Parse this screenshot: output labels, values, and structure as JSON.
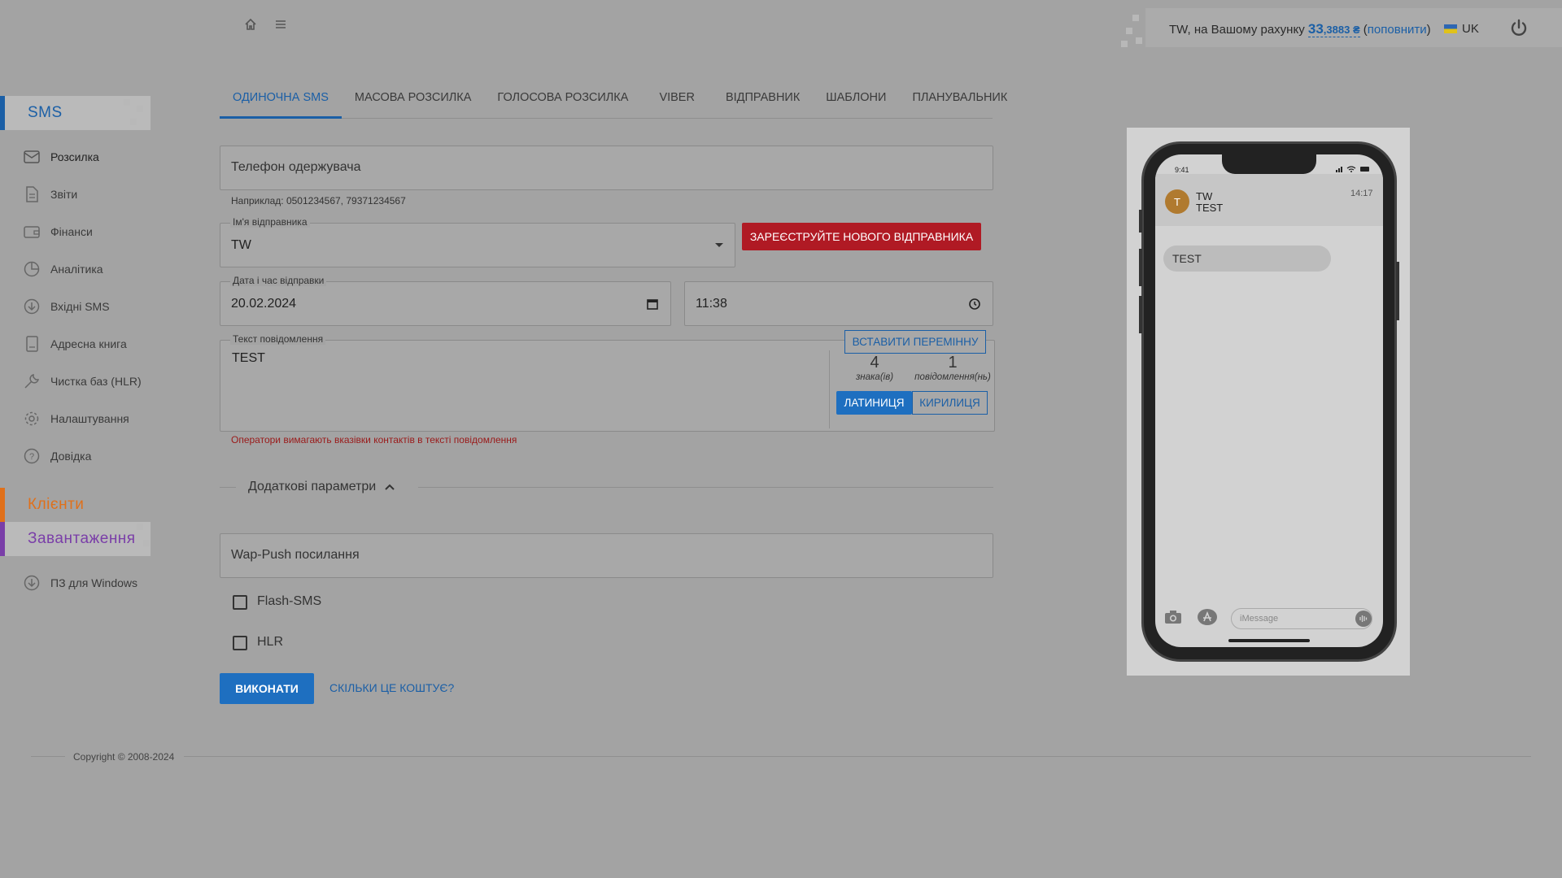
{
  "topbar": {
    "balance_prefix": "TW, на Вашому рахунку",
    "balance_int": "33",
    "balance_frac": ",3883 ₴",
    "topup_open": "(",
    "topup_label": "поповнити",
    "topup_close": ")",
    "language": "UK"
  },
  "sidebar": {
    "sms_header": "SMS",
    "items": [
      {
        "label": "Розсилка",
        "icon": "envelope-icon"
      },
      {
        "label": "Звіти",
        "icon": "document-icon"
      },
      {
        "label": "Фінанси",
        "icon": "wallet-icon"
      },
      {
        "label": "Аналітика",
        "icon": "pie-chart-icon"
      },
      {
        "label": "Вхідні SMS",
        "icon": "download-circle-icon"
      },
      {
        "label": "Адресна книга",
        "icon": "book-icon"
      },
      {
        "label": "Чистка баз (HLR)",
        "icon": "wrench-icon"
      },
      {
        "label": "Налаштування",
        "icon": "gear-icon"
      },
      {
        "label": "Довідка",
        "icon": "help-circle-icon"
      }
    ],
    "clients_header": "Клієнти",
    "downloads_header": "Завантаження",
    "windows_item": "ПЗ для Windows",
    "colors": {
      "sms": "#1b5fa6",
      "clients": "#e0701a",
      "downloads": "#7a3ea8"
    }
  },
  "tabs": [
    "ОДИНОЧНА SMS",
    "МАСОВА РОЗСИЛКА",
    "ГОЛОСОВА РОЗСИЛКА",
    "VIBER",
    "ВІДПРАВНИК",
    "ШАБЛОНИ",
    "ПЛАНУВАЛЬНИК"
  ],
  "form": {
    "phone_placeholder": "Телефон одержувача",
    "phone_hint": "Наприклад: 0501234567, 79371234567",
    "sender_label": "Ім'я відправника",
    "sender_value": "TW",
    "register_sender_button": "ЗАРЕЄСТРУЙТЕ НОВОГО ВІДПРАВНИКА",
    "datetime_label": "Дата і час відправки",
    "date_value": "20.02.2024",
    "time_value": "11:38",
    "message_label": "Текст повідомлення",
    "message_value": "TEST",
    "insert_variable_button": "ВСТАВИТИ ПЕРЕМІННУ",
    "chars_count": "4",
    "chars_label": "знака(ів)",
    "messages_count": "1",
    "messages_label": "повідомлення(нь)",
    "latin_button": "ЛАТИНИЦЯ",
    "cyrillic_button": "КИРИЛИЦЯ",
    "operators_warning": "Оператори вимагають вказівки контактів в тексті повідомлення",
    "extra_params": "Додаткові параметри",
    "wap_push_placeholder": "Wap-Push посилання",
    "flash_sms": "Flash-SMS",
    "hlr": "HLR",
    "submit_button": "ВИКОНАТИ",
    "cost_link": "СКІЛЬКИ ЦЕ КОШТУЄ?"
  },
  "phone_preview": {
    "time": "9:41",
    "avatar_letter": "T",
    "sender": "TW",
    "subtitle": "TEST",
    "message_time": "14:17",
    "bubble_text": "TEST",
    "imessage_placeholder": "iMessage"
  },
  "footer": {
    "copyright": "Copyright © 2008-2024"
  }
}
